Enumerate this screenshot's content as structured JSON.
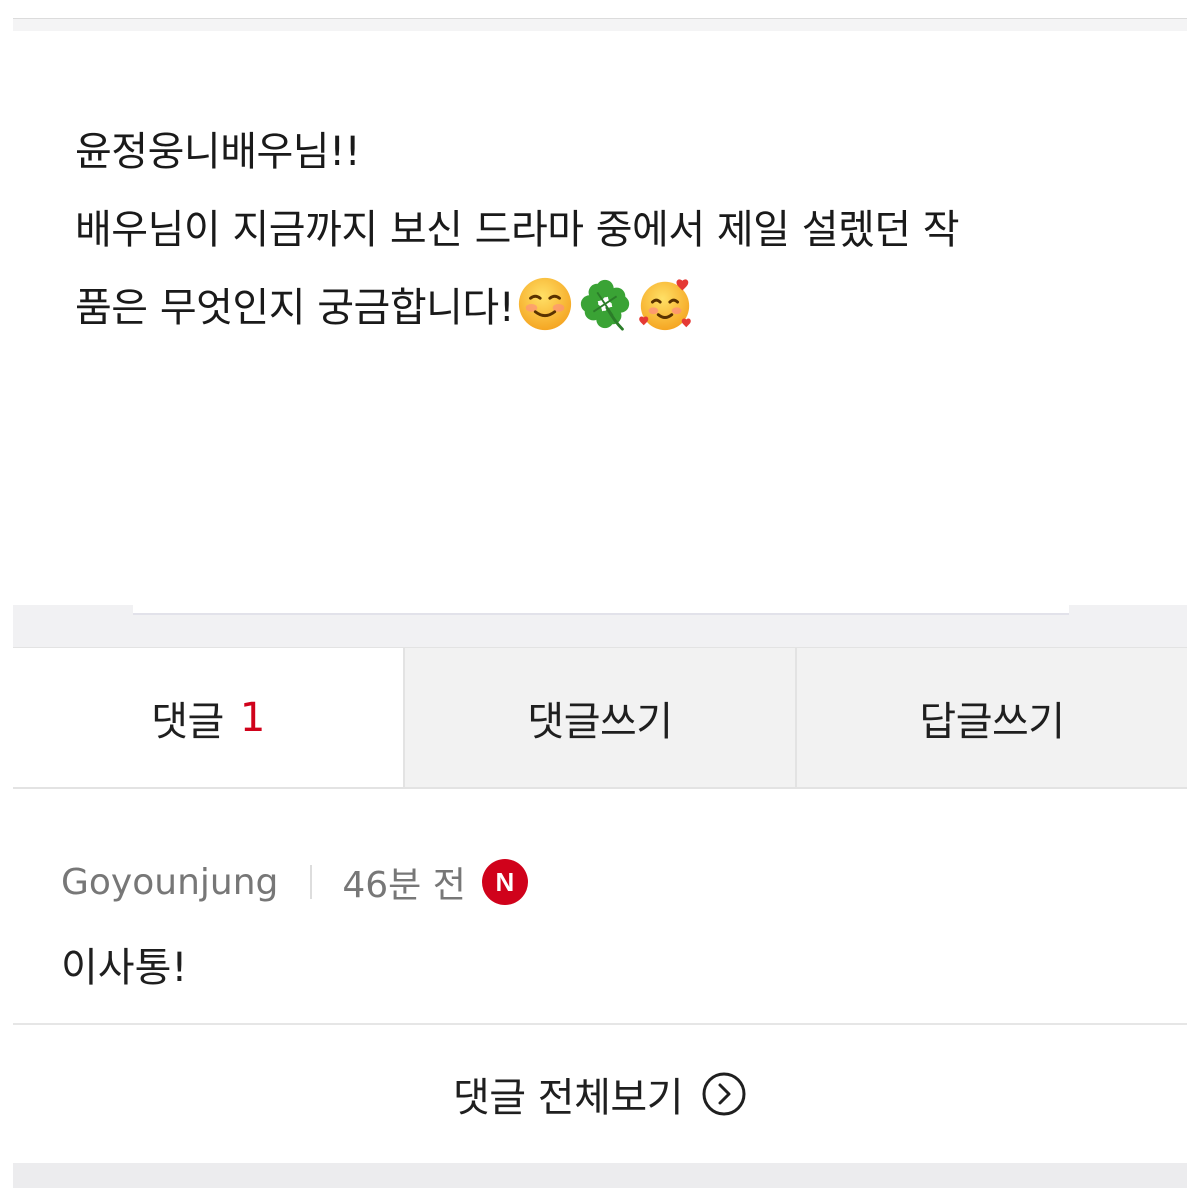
{
  "post": {
    "lines": [
      "윤정웅니배우님!!",
      "배우님이 지금까지 보신 드라마 중에서 제일 설렜던 작",
      "품은 무엇인지 궁금합니다!"
    ],
    "emojis": [
      "smiling-face-icon",
      "four-leaf-clover-icon",
      "smiling-face-with-hearts-icon"
    ]
  },
  "tabs": {
    "comments_label": "댓글",
    "comments_count": "1",
    "write_comment_label": "댓글쓰기",
    "write_reply_label": "답글쓰기"
  },
  "comment": {
    "author": "Goyounjung",
    "time": "46분 전",
    "new_badge": "N",
    "text": "이사통!"
  },
  "view_all": {
    "label": "댓글 전체보기"
  },
  "colors": {
    "accent_red": "#d0021b",
    "tab_bg": "#f2f2f2",
    "text_primary": "#1f1f1f",
    "text_meta": "#777777"
  }
}
